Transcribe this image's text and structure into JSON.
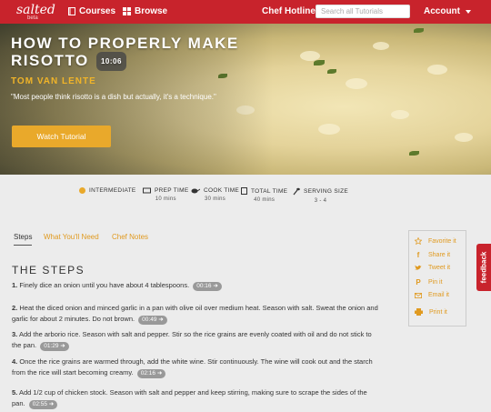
{
  "nav": {
    "logo": "salted",
    "logo_beta": "beta",
    "courses": "Courses",
    "browse": "Browse",
    "chef_hotline": "Chef Hotline",
    "search_placeholder": "Search all Tutorials",
    "account": "Account"
  },
  "hero": {
    "title": "HOW TO PROPERLY MAKE RISOTTO",
    "duration": "10:06",
    "author": "TOM VAN LENTE",
    "quote": "\"Most people think risotto is a dish but actually, it's a technique.\"",
    "watch_label": "Watch Tutorial"
  },
  "meta": {
    "difficulty": "INTERMEDIATE",
    "prep_label": "PREP TIME",
    "prep_value": "10 mins",
    "cook_label": "COOK TIME",
    "cook_value": "30 mins",
    "total_label": "TOTAL TIME",
    "total_value": "40 mins",
    "serving_label": "SERVING SIZE",
    "serving_value": "3 - 4",
    "accent_color": "#e9a92b"
  },
  "tabs": [
    "Steps",
    "What You'll Need",
    "Chef Notes"
  ],
  "steps_heading": "THE STEPS",
  "steps": [
    {
      "num": "1.",
      "text": "Finely dice an onion until you have about 4 tablespoons.",
      "time": "00:16"
    },
    {
      "num": "2.",
      "text": "Heat the diced onion and minced garlic in a pan with olive oil over medium heat. Season with salt. Sweat the onion and garlic for about 2 minutes. Do not brown.",
      "time": "00:49"
    },
    {
      "num": "3.",
      "text": "Add the arborio rice. Season with salt and pepper. Stir so the rice grains are evenly coated with oil and do not stick to the pan.",
      "time": "01:29"
    },
    {
      "num": "4.",
      "text": "Once the rice grains are warmed through, add the white wine. Stir continuously. The wine will cook out and the starch from the rice will start becoming creamy.",
      "time": "02:16"
    },
    {
      "num": "5.",
      "text": "Add 1/2 cup of chicken stock. Season with salt and pepper and keep stirring, making sure to scrape the sides of the pan.",
      "time": "02:55"
    }
  ],
  "share": {
    "favorite": "Favorite it",
    "share": "Share it",
    "tweet": "Tweet it",
    "pin": "Pin it",
    "email": "Email it",
    "print": "Print it"
  },
  "feedback": "feedback",
  "colors": {
    "brand": "#c8232c",
    "accent": "#e9a92b"
  }
}
